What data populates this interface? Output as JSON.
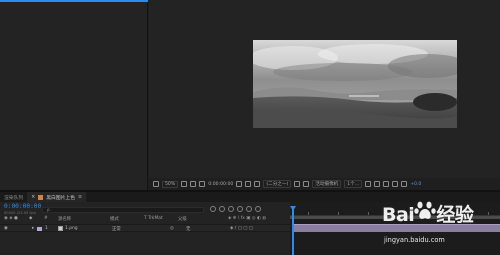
{
  "viewer_toolbar": {
    "zoom": "50%",
    "timecode": "0:00:00:00",
    "resolution": "(二分之一)",
    "camera": "活动摄像机",
    "views": "1个...",
    "exposure": "+0.0"
  },
  "tabs": [
    {
      "label": "渲染队列"
    },
    {
      "label": "黑白图片上色",
      "close": "≡"
    }
  ],
  "timeline": {
    "current_time": "0:00:00:00",
    "time_sub": "00000 (25.00 fps)",
    "search_placeholder": "ρ.",
    "columns": {
      "index": "#",
      "source_name": "源名称",
      "mode": "模式",
      "trkmat": "T  TrkMat",
      "parent": "父级"
    },
    "layers": [
      {
        "index": "1",
        "name": "1.png",
        "mode": "正常",
        "parent": "无"
      }
    ]
  },
  "watermark": {
    "brand": "Bai",
    "brand_suffix": "经验",
    "url": "jingyan.baidu.com"
  },
  "colors": {
    "accent": "#2d8ceb",
    "layer_label": "#b4a7d6",
    "comp_tab_swatch": "#d6823f"
  }
}
